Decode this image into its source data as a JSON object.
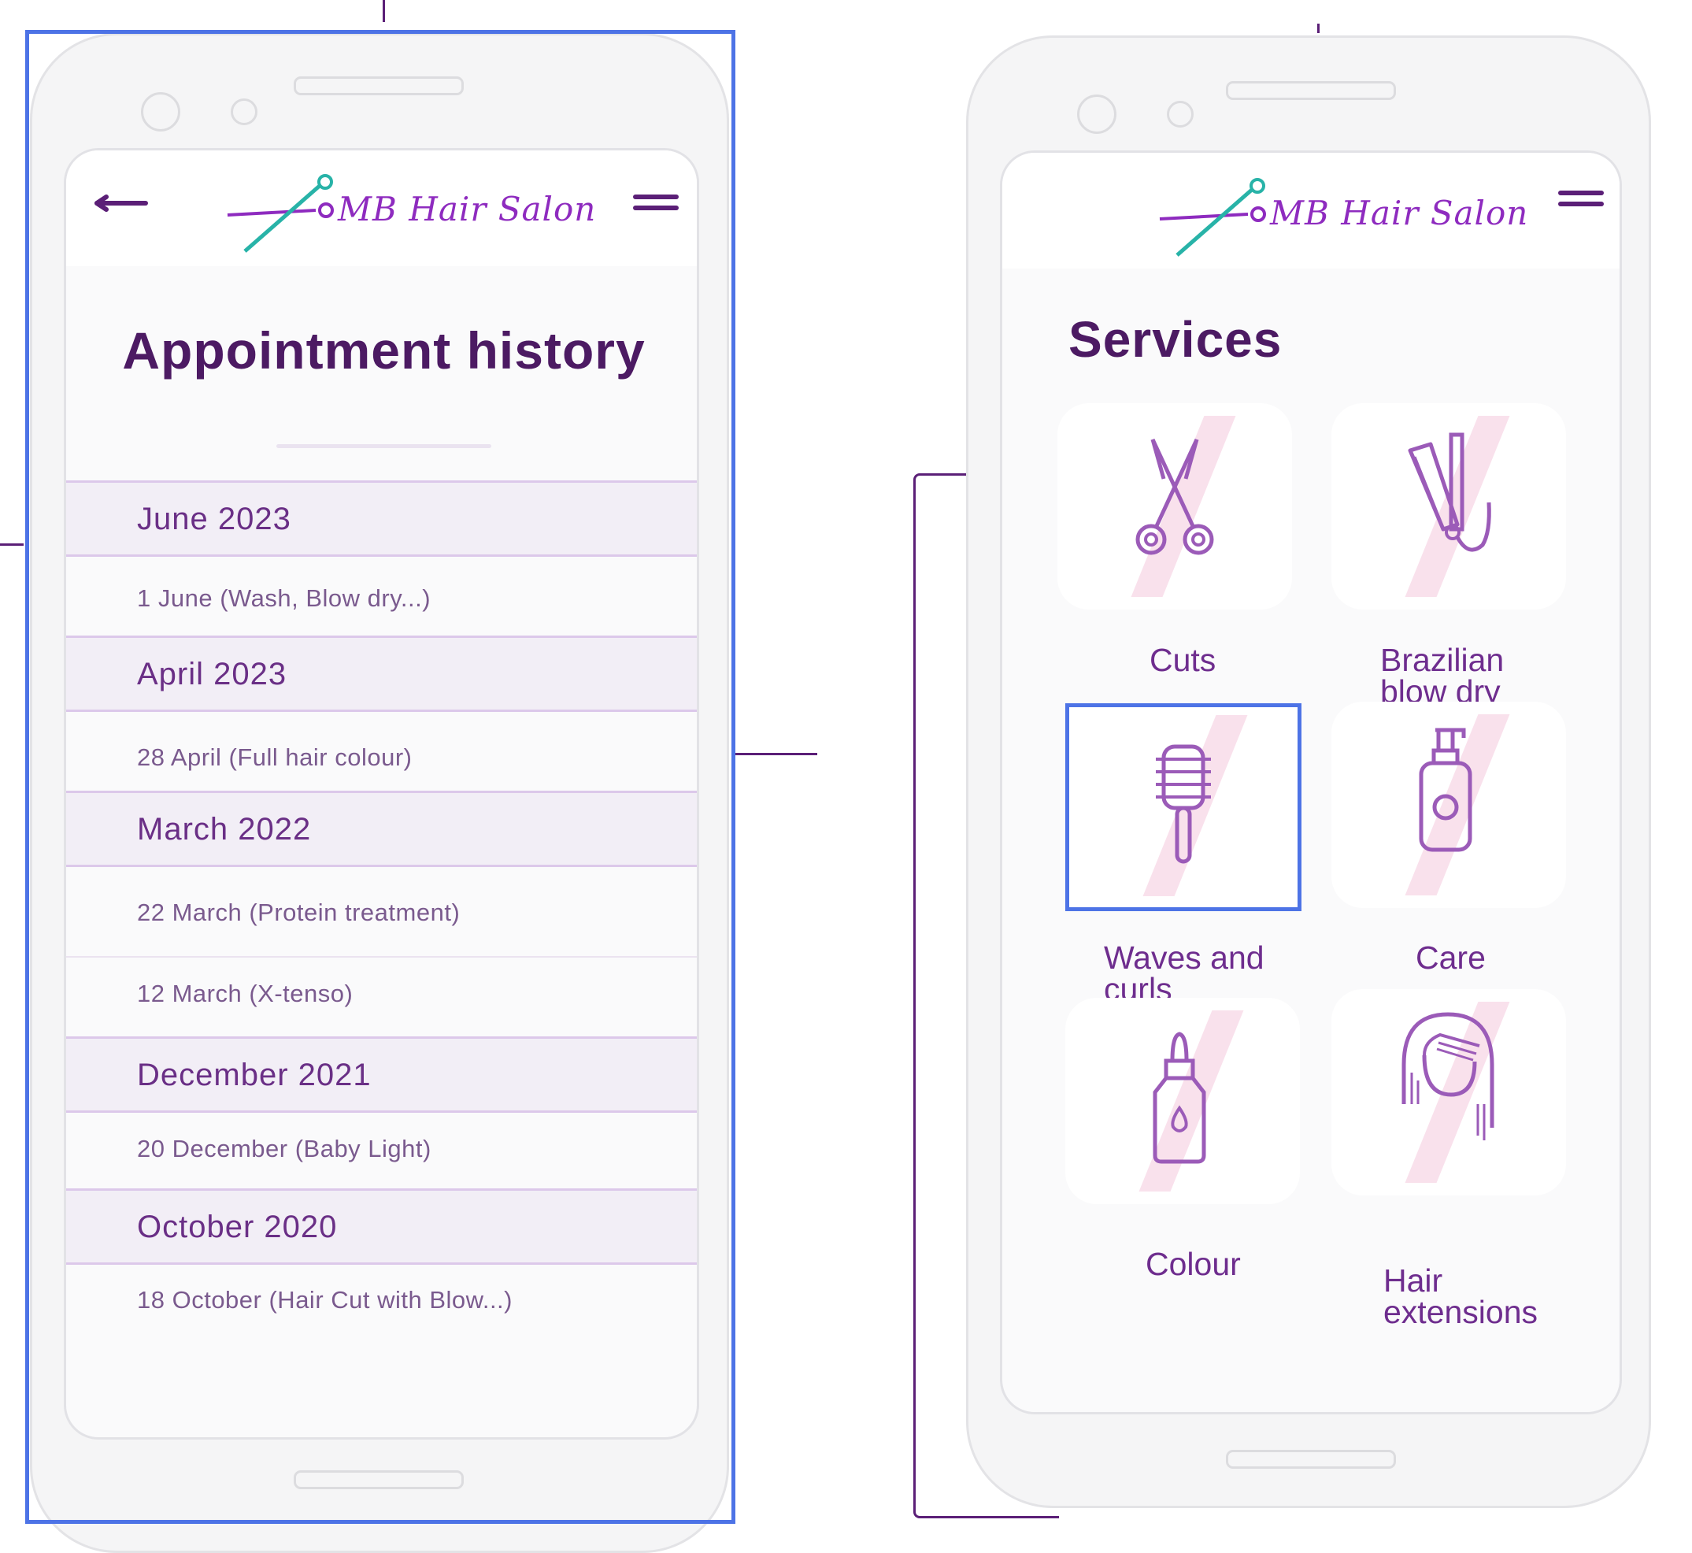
{
  "left_screen": {
    "header": {
      "back_label": "Back",
      "logo_text": "MB Hair Salon"
    },
    "title": "Appointment history",
    "groups": [
      {
        "month": "June 2023",
        "entries": [
          "1 June (Wash, Blow dry...)"
        ]
      },
      {
        "month": "April 2023",
        "entries": [
          "28 April (Full hair colour)"
        ]
      },
      {
        "month": "March 2022",
        "entries": [
          "22 March (Protein treatment)",
          "12 March (X-tenso)"
        ]
      },
      {
        "month": "December 2021",
        "entries": [
          "20 December (Baby Light)"
        ]
      },
      {
        "month": "October 2020",
        "entries": [
          "18 October (Hair Cut with Blow...)"
        ]
      }
    ]
  },
  "right_screen": {
    "header": {
      "logo_text": "MB Hair Salon"
    },
    "title": "Services",
    "services": [
      {
        "label_lines": [
          "Cuts"
        ],
        "icon": "scissors-icon"
      },
      {
        "label_lines": [
          "Brazilian",
          "blow dry"
        ],
        "icon": "hair-straightener-icon"
      },
      {
        "label_lines": [
          "Waves and",
          "curls"
        ],
        "icon": "round-brush-icon",
        "selected": true
      },
      {
        "label_lines": [
          "Care"
        ],
        "icon": "pump-bottle-icon"
      },
      {
        "label_lines": [
          "Colour"
        ],
        "icon": "dropper-bottle-icon"
      },
      {
        "label_lines": [
          "Hair",
          "extensions"
        ],
        "icon": "long-hair-icon"
      }
    ]
  },
  "colors": {
    "brand_purple": "#5b1f77",
    "accent_teal": "#28b3a8",
    "selection_blue": "#4d73e6"
  }
}
